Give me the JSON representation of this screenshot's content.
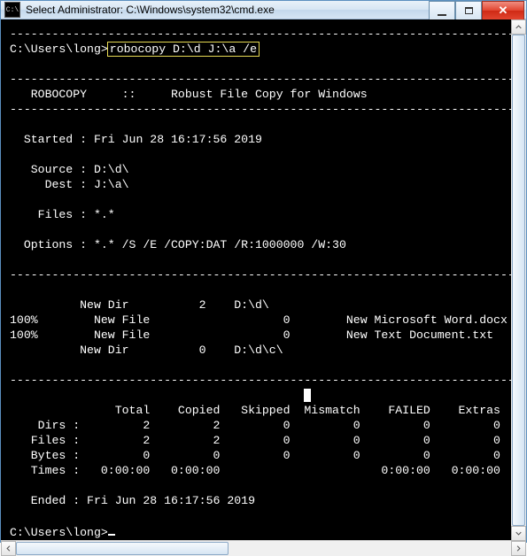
{
  "window": {
    "title": "Select Administrator: C:\\Windows\\system32\\cmd.exe",
    "icon_label": "C:\\"
  },
  "prompt1": "C:\\Users\\long>",
  "command": "robocopy D:\\d J:\\a /e",
  "divider": "-------------------------------------------------------------------------------",
  "header_line": "   ROBOCOPY     ::     Robust File Copy for Windows",
  "started_line": "  Started : Fri Jun 28 16:17:56 2019",
  "source_line": "   Source : D:\\d\\",
  "dest_line": "     Dest : J:\\a\\",
  "files_line": "    Files : *.*",
  "options_line": "  Options : *.* /S /E /COPY:DAT /R:1000000 /W:30",
  "op1": "          New Dir          2    D:\\d\\",
  "op2": "100%        New File                   0        New Microsoft Word.docx",
  "op3": "100%        New File                   0        New Text Document.txt",
  "op4": "          New Dir          0    D:\\d\\c\\",
  "summary": {
    "header": "               Total    Copied   Skipped  Mismatch    FAILED    Extras",
    "dirs": "    Dirs :         2         2         0         0         0         0",
    "files": "   Files :         2         2         0         0         0         0",
    "bytes": "   Bytes :         0         0         0         0         0         0",
    "times": "   Times :   0:00:00   0:00:00                       0:00:00   0:00:00"
  },
  "ended_line": "   Ended : Fri Jun 28 16:17:56 2019",
  "prompt2": "C:\\Users\\long>"
}
